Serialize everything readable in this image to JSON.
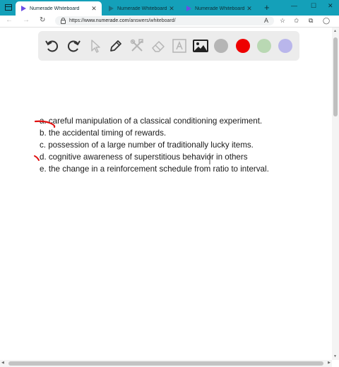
{
  "browser": {
    "tabs": [
      {
        "label": "Numerade Whiteboard",
        "active": true
      },
      {
        "label": "Numerade Whiteboard",
        "active": false
      },
      {
        "label": "Numerade Whiteboard",
        "active": false
      }
    ],
    "new_tab": "+",
    "window_controls": {
      "minimize": "—",
      "maximize": "☐",
      "close": "✕"
    },
    "url": {
      "scheme": "https://",
      "host": "www.numerade.com",
      "path": "/answers/whiteboard/"
    }
  },
  "toolbar": {
    "tools": [
      "undo-icon",
      "redo-icon",
      "pointer-icon",
      "pen-icon",
      "tools-icon",
      "eraser-icon",
      "text-icon",
      "image-icon"
    ],
    "colors": [
      "#b5b5b5",
      "#ee0000",
      "#b9d8b3",
      "#b9b6eb"
    ],
    "selected_color": "#ee0000"
  },
  "question": {
    "options": [
      "a. careful manipulation of a classical conditioning experiment.",
      "b. the accidental timing of rewards.",
      "c. possession of a large number of traditionally lucky items.",
      "d. cognitive awareness of superstitious behavior in others",
      "e. the change in a reinforcement schedule from ratio to interval."
    ]
  },
  "ink_color": "#e01010"
}
